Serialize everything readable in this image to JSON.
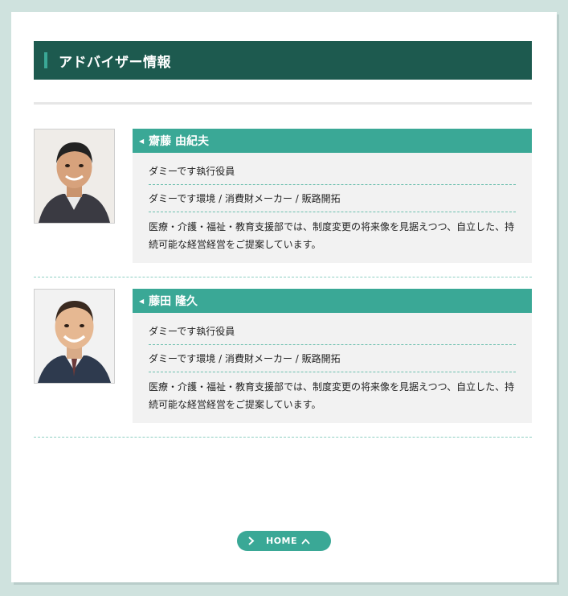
{
  "section": {
    "title": "アドバイザー情報"
  },
  "advisors": [
    {
      "name": "齋藤 由紀夫",
      "role": "ダミーです執行役員",
      "expertise": "ダミーです環境 / 消費財メーカー / 販路開拓",
      "description": "医療・介護・福祉・教育支援部では、制度変更の将来像を見据えつつ、自立した、持続可能な経営経営をご提案しています。"
    },
    {
      "name": "藤田 隆久",
      "role": "ダミーです執行役員",
      "expertise": "ダミーです環境 / 消費財メーカー / 販路開拓",
      "description": "医療・介護・福祉・教育支援部では、制度変更の将来像を見据えつつ、自立した、持続可能な経営経営をご提案しています。"
    }
  ],
  "home_button": {
    "label": "HOME"
  },
  "colors": {
    "page_bg": "#cfe2de",
    "header_bg": "#1d5a4f",
    "accent": "#3aa896",
    "detail_bg": "#f2f2f2"
  }
}
